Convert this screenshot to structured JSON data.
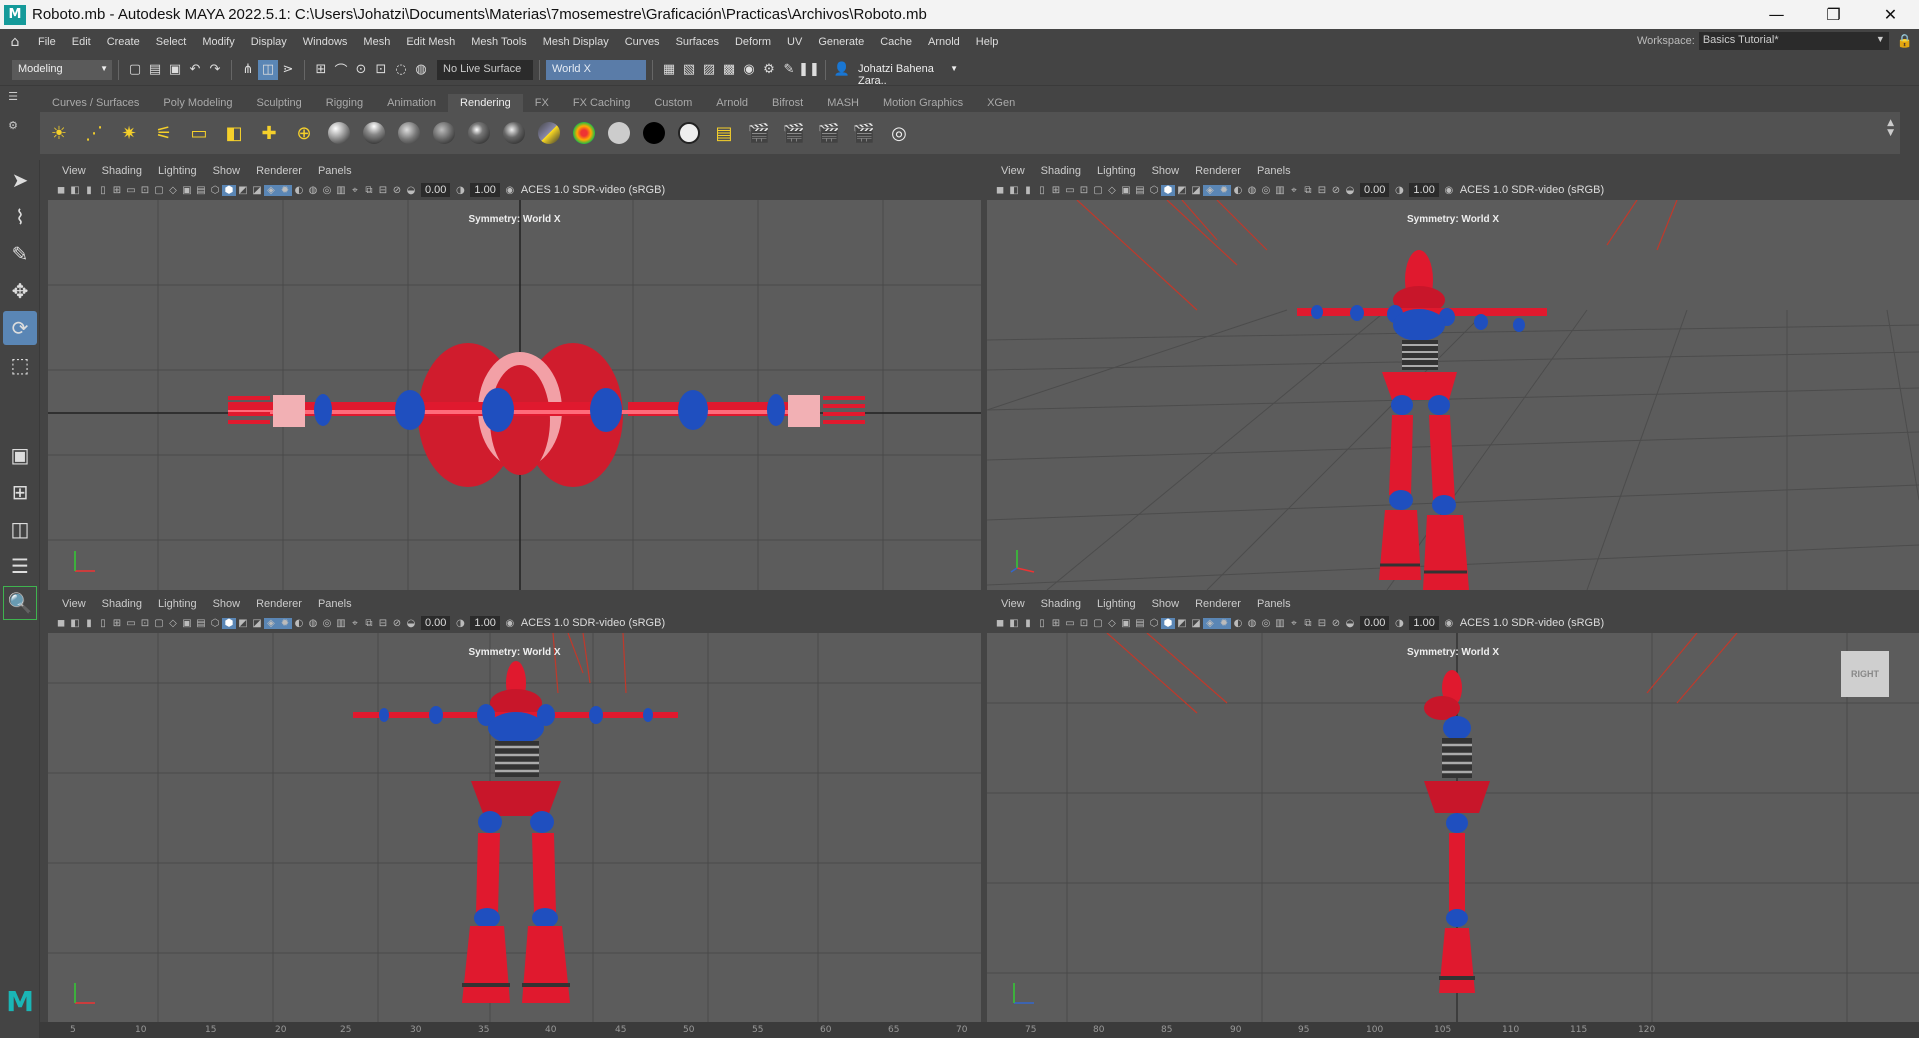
{
  "window": {
    "title": "Roboto.mb - Autodesk MAYA 2022.5.1: C:\\Users\\Johatzi\\Documents\\Materias\\7mosemestre\\Graficación\\Practicas\\Archivos\\Roboto.mb",
    "logo_letter": "M",
    "minimize": "—",
    "maximize": "❐",
    "close": "✕"
  },
  "menubar": {
    "items": [
      "File",
      "Edit",
      "Create",
      "Select",
      "Modify",
      "Display",
      "Windows",
      "Mesh",
      "Edit Mesh",
      "Mesh Tools",
      "Mesh Display",
      "Curves",
      "Surfaces",
      "Deform",
      "UV",
      "Generate",
      "Cache",
      "Arnold",
      "Help"
    ],
    "workspace_label": "Workspace:",
    "workspace_value": "Basics Tutorial*"
  },
  "statusline": {
    "menu_set": "Modeling",
    "live_surface": "No Live Surface",
    "symmetry": "World X",
    "user": "Johatzi Bahena Zara.."
  },
  "shelf": {
    "tabs": [
      "Curves / Surfaces",
      "Poly Modeling",
      "Sculpting",
      "Rigging",
      "Animation",
      "Rendering",
      "FX",
      "FX Caching",
      "Custom",
      "Arnold",
      "Bifrost",
      "MASH",
      "Motion Graphics",
      "XGen"
    ],
    "active_tab": "Rendering"
  },
  "viewport_common": {
    "menus": [
      "View",
      "Shading",
      "Lighting",
      "Show",
      "Renderer",
      "Panels"
    ],
    "exposure": "0.00",
    "gamma": "1.00",
    "colorspace": "ACES 1.0 SDR-video (sRGB)",
    "symmetry_label": "Symmetry: World X"
  },
  "viewports": {
    "right_cube_label": "RIGHT"
  },
  "timeline": {
    "ticks": [
      "5",
      "10",
      "15",
      "20",
      "25",
      "30",
      "35",
      "40",
      "45",
      "50",
      "55",
      "60",
      "65",
      "70",
      "75",
      "80",
      "85",
      "90",
      "95",
      "100",
      "105",
      "110",
      "115",
      "120"
    ]
  },
  "colors": {
    "robot_red": "#e0192e",
    "robot_blue": "#1f4fbf",
    "viewport_bg": "#5c5c5c",
    "accent_blue": "#5a86b5"
  }
}
